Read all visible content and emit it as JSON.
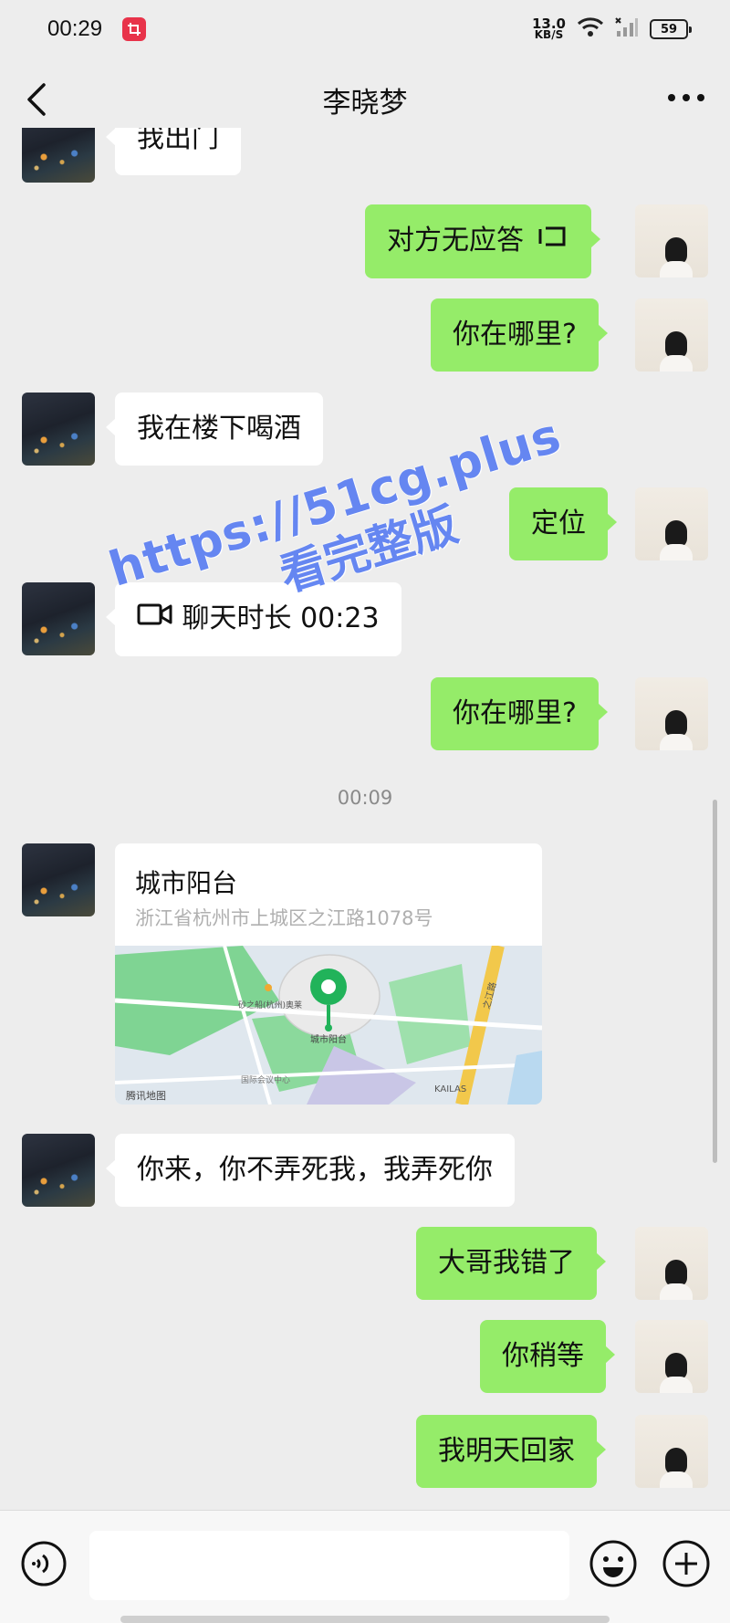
{
  "status_bar": {
    "time": "00:29",
    "net_speed_value": "13.0",
    "net_speed_unit": "KB/S",
    "battery": "59"
  },
  "header": {
    "title": "李晓梦"
  },
  "messages": [
    {
      "side": "left",
      "text": "我出门"
    },
    {
      "side": "right",
      "text": "对方无应答"
    },
    {
      "side": "right",
      "text": "你在哪里?"
    },
    {
      "side": "left",
      "text": "我在楼下喝酒"
    },
    {
      "side": "right",
      "text": "定位"
    },
    {
      "side": "left",
      "text": "聊天时长 00:23"
    },
    {
      "side": "right",
      "text": "你在哪里?"
    },
    {
      "side": "left",
      "text": "你来，你不弄死我，我弄死你"
    },
    {
      "side": "right",
      "text": "大哥我错了"
    },
    {
      "side": "right",
      "text": "你稍等"
    },
    {
      "side": "right",
      "text": "我明天回家"
    }
  ],
  "timestamp": "00:09",
  "location": {
    "name": "城市阳台",
    "address": "浙江省杭州市上城区之江路1078号",
    "map_label": "城市阳台",
    "provider": "腾讯地图",
    "poi_1": "砂之船(杭州)奥莱",
    "poi_2": "国际会议中心",
    "poi_3": "KAILAS",
    "road": "之江路"
  },
  "watermark": {
    "line1": "https://51cg.plus",
    "line2": "看完整版"
  },
  "colors": {
    "bubble_right": "#95ec69",
    "bubble_left": "#ffffff",
    "background": "#ededed",
    "watermark": "#5a7ef2",
    "map_pin": "#21b35a"
  },
  "icons": [
    "back-icon",
    "more-icon",
    "voice-call-icon",
    "video-call-icon",
    "voice-input-icon",
    "emoji-icon",
    "plus-icon"
  ]
}
